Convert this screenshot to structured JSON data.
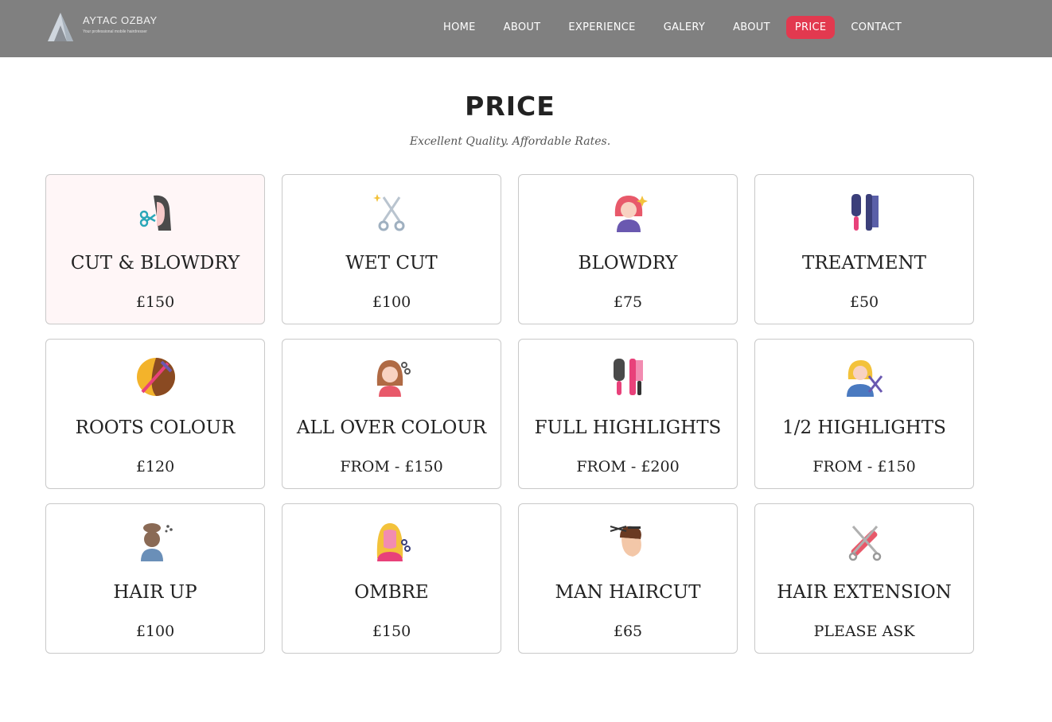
{
  "header": {
    "logo_name": "AYTAC OZBAY",
    "logo_tagline": "Your professional mobile hairdresser",
    "background": "#808080",
    "nav": [
      {
        "label": "HOME",
        "active": false
      },
      {
        "label": "ABOUT",
        "active": false
      },
      {
        "label": "EXPERIENCE",
        "active": false
      },
      {
        "label": "GALERY",
        "active": false
      },
      {
        "label": "ABOUT",
        "active": false
      },
      {
        "label": "PRICE",
        "active": true
      },
      {
        "label": "CONTACT",
        "active": false
      }
    ],
    "active_color": "#e2394f"
  },
  "section": {
    "title": "PRICE",
    "subtitle": "Excellent Quality. Affordable Rates."
  },
  "services": [
    {
      "name": "CUT & BLOWDRY",
      "price": "£150",
      "icon": "haircut-woman-icon"
    },
    {
      "name": "WET CUT",
      "price": "£100",
      "icon": "scissors-icon"
    },
    {
      "name": "BLOWDRY",
      "price": "£75",
      "icon": "styled-hair-woman-icon"
    },
    {
      "name": "TREATMENT",
      "price": "£50",
      "icon": "brush-comb-icon"
    },
    {
      "name": "ROOTS COLOUR",
      "price": "£120",
      "icon": "hair-dye-icon"
    },
    {
      "name": "ALL OVER COLOUR",
      "price": "FROM - £150",
      "icon": "coloured-hair-woman-icon"
    },
    {
      "name": "FULL HIGHLIGHTS",
      "price": "FROM - £200",
      "icon": "round-brush-comb-icon"
    },
    {
      "name": "1/2 HIGHLIGHTS",
      "price": "FROM - £150",
      "icon": "hairdresser-scissors-icon"
    },
    {
      "name": "HAIR UP",
      "price": "£100",
      "icon": "updo-hair-icon"
    },
    {
      "name": "OMBRE",
      "price": "£150",
      "icon": "blonde-woman-scissors-icon"
    },
    {
      "name": "MAN HAIRCUT",
      "price": "£65",
      "icon": "man-haircut-icon"
    },
    {
      "name": "HAIR EXTENSION",
      "price": "PLEASE ASK",
      "icon": "scissors-comb-icon"
    }
  ]
}
